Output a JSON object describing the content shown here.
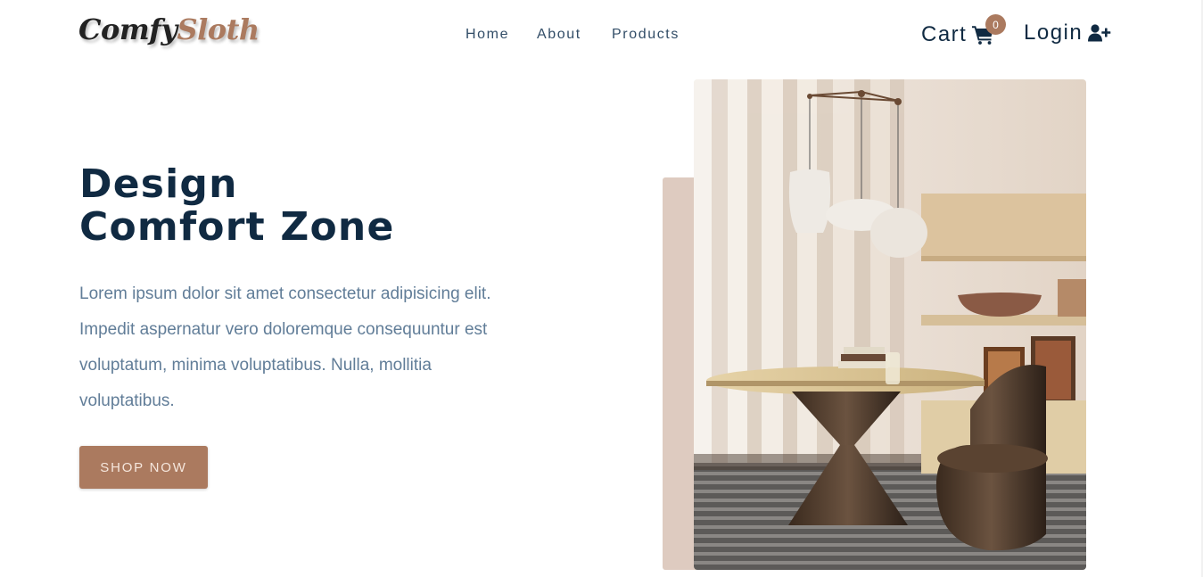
{
  "nav": {
    "logo": {
      "part1": "Comfy",
      "part2": "Sloth"
    },
    "links": [
      {
        "label": "Home"
      },
      {
        "label": "About"
      },
      {
        "label": "Products"
      }
    ],
    "cart": {
      "label": "Cart",
      "count": "0",
      "icon": "shopping-cart-icon"
    },
    "login": {
      "label": "Login",
      "icon": "user-plus-icon"
    }
  },
  "hero": {
    "title_line1": "Design",
    "title_line2": "Comfort Zone",
    "text": "Lorem ipsum dolor sit amet consectetur adipisicing elit. Impedit aspernatur vero doloremque consequuntur est voluptatum, minima voluptatibus. Nulla, mollitia voluptatibus.",
    "button": "shop now"
  },
  "colors": {
    "brand": "#ab7a5f",
    "heading": "#102a42",
    "body_text": "#617d98",
    "accent_block": "#decbc0"
  }
}
